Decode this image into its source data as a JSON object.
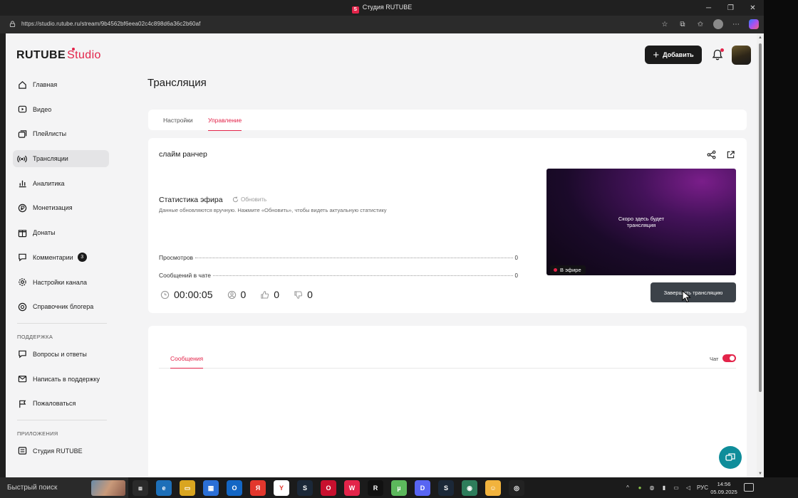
{
  "window": {
    "title": "Студия RUTUBE",
    "app_icon_letter": "S",
    "controls": {
      "minimize": "─",
      "maximize": "❐",
      "close": "✕"
    }
  },
  "browser": {
    "url": "https://studio.rutube.ru/stream/9b4562bf6eea02c4c898d6a36c2b60af"
  },
  "header": {
    "logo_main": "RUTUBE",
    "logo_sub": "Studio",
    "add_button": "Добавить"
  },
  "sidebar": {
    "items": [
      {
        "label": "Главная",
        "icon": "home-icon"
      },
      {
        "label": "Видео",
        "icon": "video-icon"
      },
      {
        "label": "Плейлисты",
        "icon": "playlist-icon"
      },
      {
        "label": "Трансляции",
        "icon": "broadcast-icon",
        "active": true
      },
      {
        "label": "Аналитика",
        "icon": "analytics-icon"
      },
      {
        "label": "Монетизация",
        "icon": "money-icon"
      },
      {
        "label": "Донаты",
        "icon": "donate-icon"
      },
      {
        "label": "Комментарии",
        "icon": "comments-icon",
        "count": "3"
      },
      {
        "label": "Настройки канала",
        "icon": "gear-icon"
      },
      {
        "label": "Справочник блогера",
        "icon": "help-icon"
      }
    ],
    "support_title": "ПОДДЕРЖКА",
    "support_items": [
      {
        "label": "Вопросы и ответы",
        "icon": "faq-icon"
      },
      {
        "label": "Написать в поддержку",
        "icon": "mail-icon"
      },
      {
        "label": "Пожаловаться",
        "icon": "flag-icon"
      }
    ],
    "apps_title": "ПРИЛОЖЕНИЯ",
    "apps_items": [
      {
        "label": "Студия RUTUBE",
        "icon": "studio-app-icon"
      }
    ]
  },
  "main": {
    "page_title": "Трансляция",
    "tabs": [
      {
        "label": "Настройки"
      },
      {
        "label": "Управление",
        "active": true
      }
    ],
    "stream": {
      "name": "слайм ранчер",
      "stats_title": "Статистика эфира",
      "refresh_label": "Обновить",
      "stats_note": "Данные обновляются вручную. Нажмите «Обновить», чтобы видеть актуальную статистику",
      "stats": [
        {
          "label": "Просмотров",
          "value": "0"
        },
        {
          "label": "Сообщений в чате",
          "value": "0"
        }
      ],
      "timer": "00:00:05",
      "viewers": "0",
      "likes": "0",
      "dislikes": "0",
      "preview_message_line1": "Скоро здесь будет",
      "preview_message_line2": "трансляция",
      "live_badge": "В эфире",
      "end_button": "Завершить трансляцию"
    },
    "chat": {
      "tab_label": "Сообщения",
      "toggle_label": "Чат",
      "toggle_on": true
    }
  },
  "taskbar": {
    "search_placeholder": "Быстрый поиск",
    "tray_language": "РУС",
    "time": "14:56",
    "date": "05.09.2025"
  },
  "colors": {
    "accent": "#e3244a",
    "dark_button": "#1b1b1b",
    "end_button": "#3c4249",
    "help_fab": "#0f8d9a"
  }
}
